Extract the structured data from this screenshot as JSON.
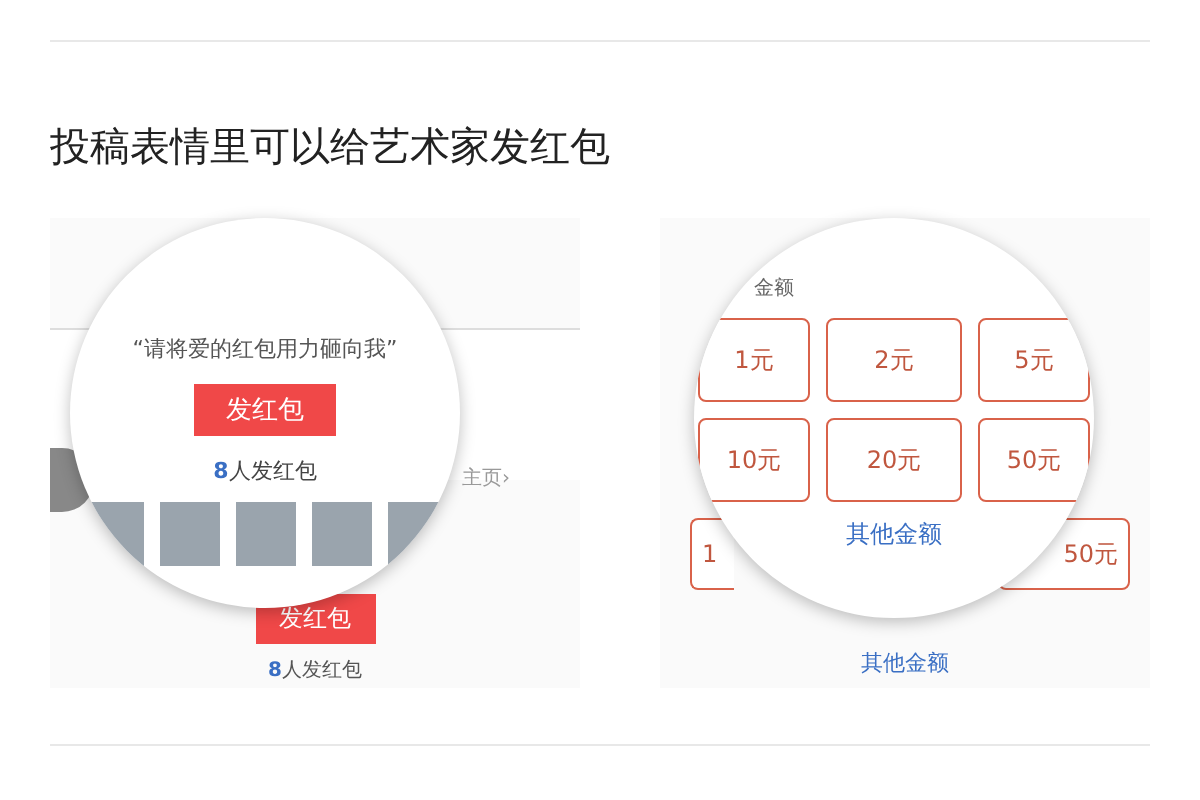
{
  "heading": "投稿表情里可以给艺术家发红包",
  "left_panel": {
    "background": {
      "link": "主页›",
      "button": "发红包",
      "count": "8",
      "count_label": "人发红包"
    },
    "magnifier": {
      "quote": "“请将爱的红包用力砸向我”",
      "button": "发红包",
      "count": "8",
      "count_label": "人发红包"
    }
  },
  "right_panel": {
    "background": {
      "cells": [
        {
          "text": "1"
        },
        {
          "text": "50元"
        }
      ],
      "link": "其他金额"
    },
    "magnifier": {
      "label": "金额",
      "amounts": [
        "1元",
        "2元",
        "5元",
        "10元",
        "20元",
        "50元"
      ],
      "link": "其他金额"
    }
  }
}
